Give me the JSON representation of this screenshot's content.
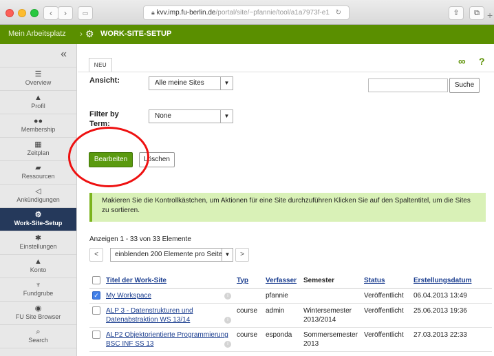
{
  "browser": {
    "url_host": "kvv.imp.fu-berlin.de",
    "url_path": "/portal/site/~pfannie/tool/a1a7973f-e1",
    "back": "‹",
    "forward": "›"
  },
  "topbar": {
    "home": "Mein Arbeitsplatz",
    "tool_title": "WORK-SITE-SETUP"
  },
  "sidebar": {
    "collapse": "«",
    "items": [
      {
        "label": "Overview",
        "icon": "☰"
      },
      {
        "label": "Profil",
        "icon": "▲"
      },
      {
        "label": "Membership",
        "icon": "●●"
      },
      {
        "label": "Zeitplan",
        "icon": "▦"
      },
      {
        "label": "Ressourcen",
        "icon": "▰"
      },
      {
        "label": "Ankündigungen",
        "icon": "◁"
      },
      {
        "label": "Work-Site-Setup",
        "icon": "⚙"
      },
      {
        "label": "Einstellungen",
        "icon": "✱"
      },
      {
        "label": "Konto",
        "icon": "▲"
      },
      {
        "label": "Fundgrube",
        "icon": "♆"
      },
      {
        "label": "FU Site Browser",
        "icon": "◉"
      },
      {
        "label": "Search",
        "icon": "⌕"
      }
    ]
  },
  "main": {
    "tab_neu": "NEU",
    "ansicht_label": "Ansicht:",
    "ansicht_value": "Alle meine Sites",
    "search_button": "Suche",
    "filter_label": "Filter by Term:",
    "filter_value": "None",
    "bearbeiten": "Bearbeiten",
    "loeschen": "Löschen",
    "notice": "Makieren Sie die Kontrollkästchen, um Aktionen für eine Site durchzuführen Klicken Sie auf den Spaltentitel, um die Sites zu sortieren.",
    "count_text": "Anzeigen 1 - 33 von 33 Elemente",
    "pager_select": "einblenden 200 Elemente pro Seite",
    "pager_prev": "<",
    "pager_next": ">"
  },
  "table": {
    "headers": [
      "Titel der Work-Site",
      "Typ",
      "Verfasser",
      "Semester",
      "Status",
      "Erstellungsdatum"
    ],
    "rows": [
      {
        "title": "My Workspace",
        "type": "",
        "author": "pfannie",
        "semester": "",
        "status": "Veröffentlicht",
        "date": "06.04.2013 13:49",
        "checked": true
      },
      {
        "title": "ALP 3 - Datenstrukturen und Datenabstraktion WS 13/14",
        "type": "course",
        "author": "admin",
        "semester": "Wintersemester 2013/2014",
        "status": "Veröffentlicht",
        "date": "25.06.2013 19:36",
        "checked": false
      },
      {
        "title": "ALP2 Objektorientierte Programmierung BSC INF SS 13",
        "type": "course",
        "author": "esponda",
        "semester": "Sommersemester 2013",
        "status": "Veröffentlicht",
        "date": "27.03.2013 22:33",
        "checked": false
      }
    ]
  },
  "colors": {
    "topbar": "#5a8f00",
    "active_nav": "#25395b",
    "notice_bg": "#d9f1b7",
    "highlight_circle": "#e11111"
  }
}
